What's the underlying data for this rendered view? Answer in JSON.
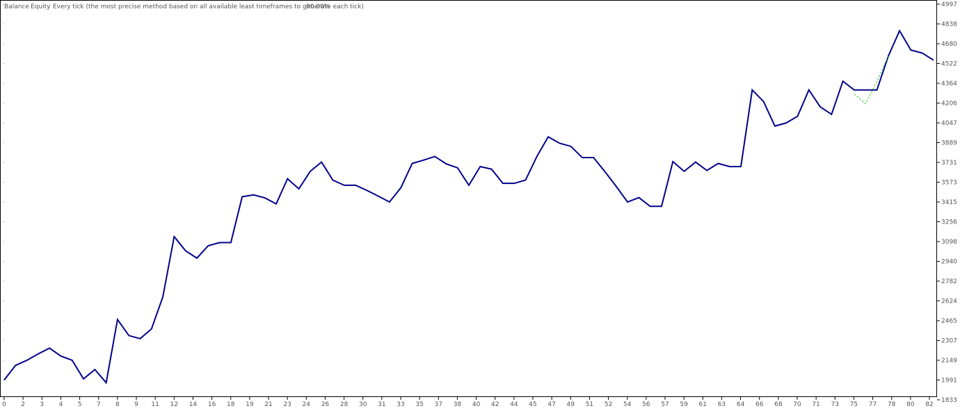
{
  "header": {
    "balance_label": "Balance",
    "equity_label": "Equity",
    "model_description": "Every tick (the most precise method based on all available least timeframes to generate each tick)",
    "modelling_quality": "90.00%"
  },
  "colors": {
    "balance": "#00008B",
    "equity": "#32CD32",
    "frame": "#000000",
    "tick_text": "#555555"
  },
  "chart_data": {
    "type": "line",
    "title": "",
    "xlabel": "",
    "ylabel": "",
    "x_tick_labels": [
      "0",
      "2",
      "3",
      "4",
      "5",
      "7",
      "8",
      "9",
      "11",
      "12",
      "14",
      "16",
      "18",
      "19",
      "21",
      "23",
      "24",
      "26",
      "28",
      "30",
      "31",
      "33",
      "35",
      "37",
      "38",
      "40",
      "42",
      "44",
      "45",
      "47",
      "49",
      "51",
      "52",
      "54",
      "56",
      "57",
      "59",
      "61",
      "63",
      "64",
      "66",
      "68",
      "70",
      "71",
      "73",
      "75",
      "77",
      "78",
      "80",
      "82"
    ],
    "y_tick_labels": [
      "4997",
      "4838",
      "4680",
      "4522",
      "4364",
      "4206",
      "4047",
      "3889",
      "3731",
      "3573",
      "3415",
      "3256",
      "3098",
      "2940",
      "2782",
      "2624",
      "2465",
      "2307",
      "2149",
      "1991",
      "1833"
    ],
    "ylim": [
      1833,
      4997
    ],
    "xlim": [
      0,
      82
    ],
    "series": [
      {
        "name": "Balance",
        "x": [
          0,
          1,
          2,
          3,
          4,
          5,
          6,
          7,
          8,
          9,
          10,
          11,
          12,
          13,
          14,
          15,
          16,
          17,
          18,
          19,
          20,
          21,
          22,
          23,
          24,
          25,
          26,
          27,
          28,
          29,
          30,
          31,
          32,
          33,
          34,
          35,
          36,
          37,
          38,
          39,
          40,
          41,
          42,
          43,
          44,
          45,
          46,
          47,
          48,
          49,
          50,
          51,
          52,
          53,
          54,
          55,
          56,
          57,
          58,
          59,
          60,
          61,
          62,
          63,
          64,
          65,
          66,
          67,
          68,
          69,
          70,
          71,
          72,
          73,
          74,
          75,
          76,
          77,
          78,
          79,
          80,
          81,
          82
        ],
        "values": [
          1991,
          2108,
          2149,
          2200,
          2246,
          2183,
          2149,
          2000,
          2075,
          1970,
          2475,
          2347,
          2322,
          2400,
          2657,
          3138,
          3025,
          2966,
          3065,
          3090,
          3090,
          3457,
          3472,
          3448,
          3400,
          3601,
          3520,
          3660,
          3734,
          3590,
          3549,
          3549,
          3508,
          3462,
          3415,
          3529,
          3723,
          3750,
          3779,
          3720,
          3688,
          3549,
          3698,
          3678,
          3564,
          3564,
          3590,
          3779,
          3936,
          3885,
          3860,
          3770,
          3770,
          3658,
          3540,
          3415,
          3450,
          3380,
          3380,
          3738,
          3660,
          3734,
          3667,
          3723,
          3698,
          3698,
          4311,
          4218,
          4022,
          4047,
          4101,
          4311,
          4176,
          4116,
          4381,
          4311,
          4311,
          4311,
          4580,
          4784,
          4630,
          4606,
          4549
        ],
        "color": "#00008B"
      },
      {
        "name": "Equity",
        "x": [
          75,
          76,
          77,
          78
        ],
        "values": [
          4280,
          4200,
          4380,
          4580
        ],
        "color": "#32CD32"
      }
    ],
    "grid": false,
    "legend": "top-left"
  }
}
